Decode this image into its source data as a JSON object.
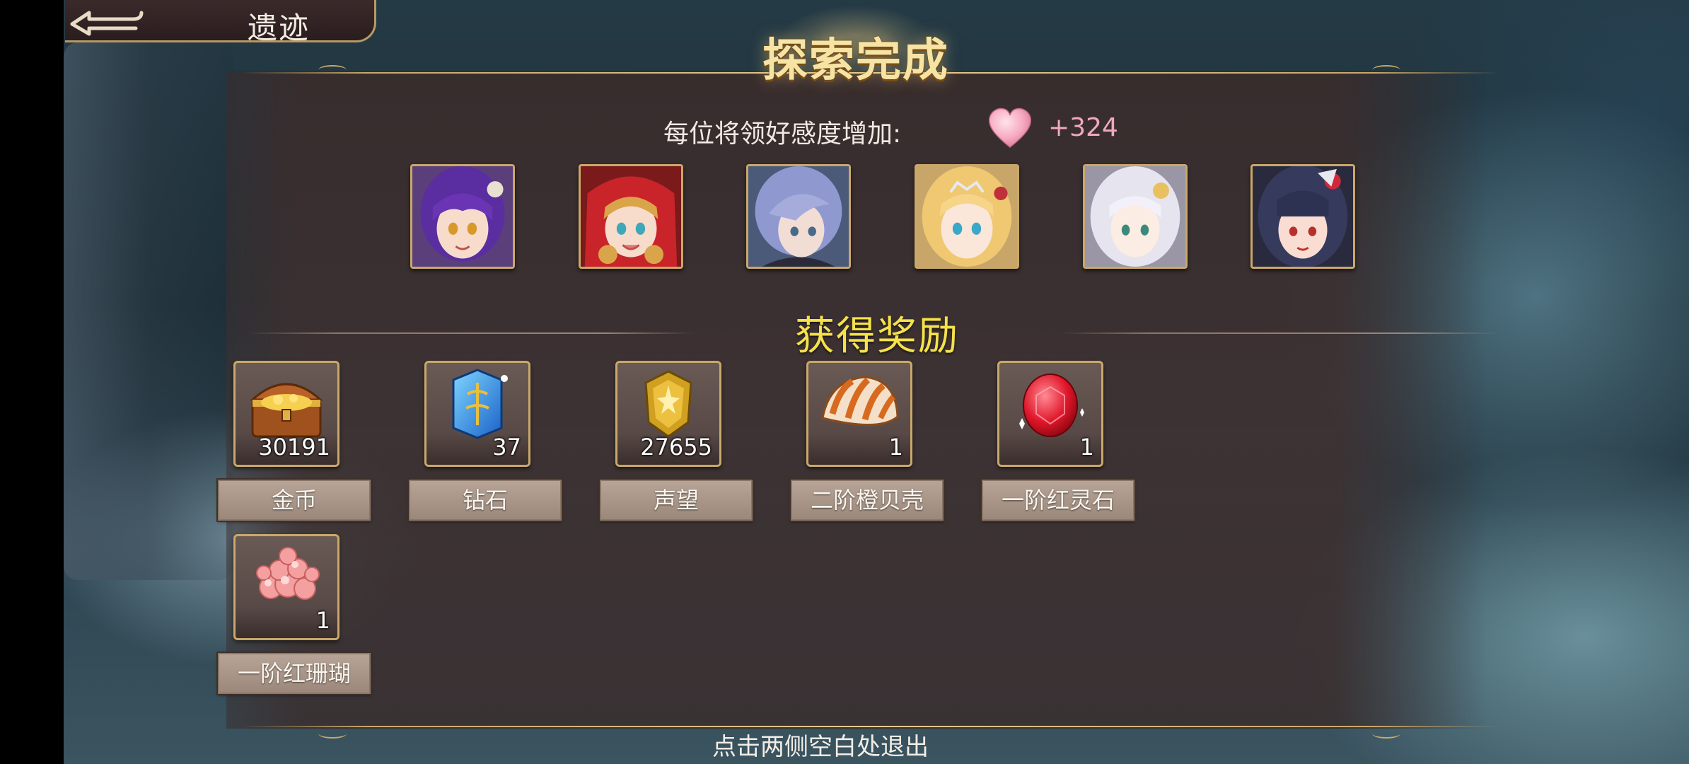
{
  "header": {
    "page_title": "遗迹",
    "title": "探索完成"
  },
  "affection": {
    "label": "每位将领好感度增加:",
    "value": "+324"
  },
  "portraits": [
    {
      "name": "portrait-1"
    },
    {
      "name": "portrait-2"
    },
    {
      "name": "portrait-3"
    },
    {
      "name": "portrait-4"
    },
    {
      "name": "portrait-5"
    },
    {
      "name": "portrait-6"
    }
  ],
  "rewards": {
    "title": "获得奖励",
    "items": [
      {
        "name": "金币",
        "count": "30191",
        "icon": "treasure-chest-icon"
      },
      {
        "name": "钻石",
        "count": "37",
        "icon": "diamond-crystal-icon"
      },
      {
        "name": "声望",
        "count": "27655",
        "icon": "prestige-medal-icon"
      },
      {
        "name": "二阶橙贝壳",
        "count": "1",
        "icon": "orange-shell-icon"
      },
      {
        "name": "一阶红灵石",
        "count": "1",
        "icon": "red-gem-icon"
      },
      {
        "name": "一阶红珊瑚",
        "count": "1",
        "icon": "red-coral-icon"
      }
    ]
  },
  "footer": {
    "hint": "点击两侧空白处退出"
  },
  "colors": {
    "gold_border": "#c9a86a",
    "rewards_title": "#f5e24a",
    "affection_value": "#f2a8c0"
  }
}
